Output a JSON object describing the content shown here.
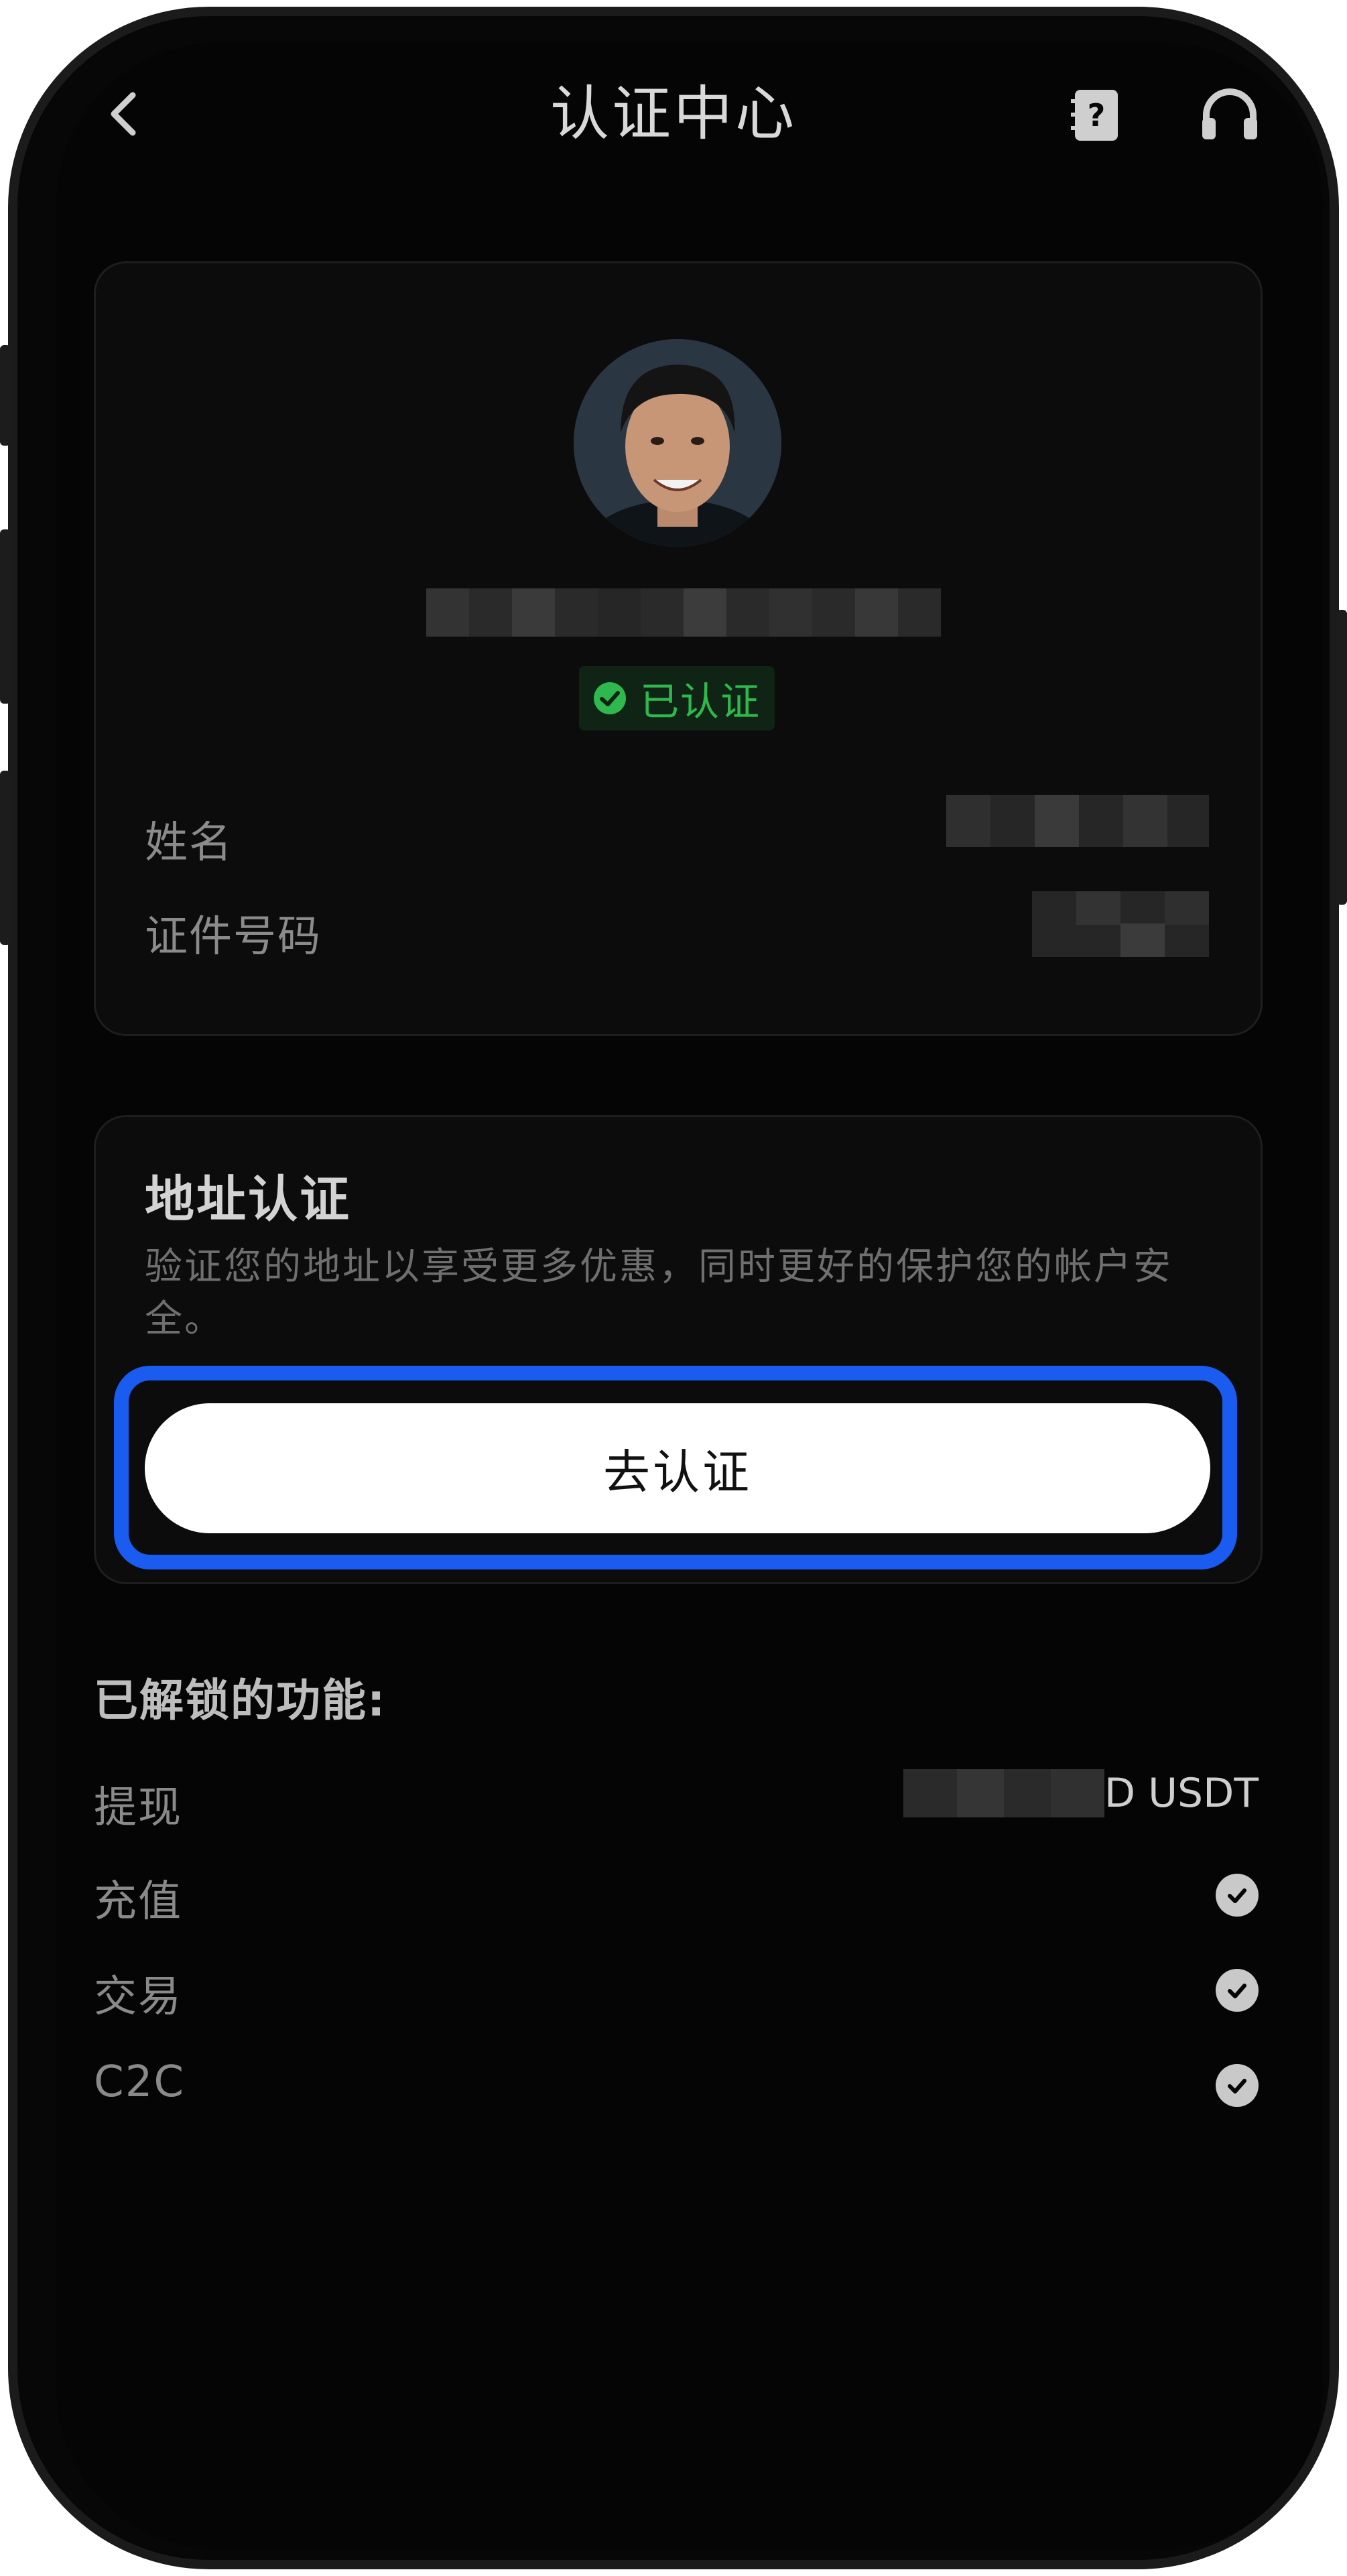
{
  "header": {
    "title": "认证中心",
    "back_icon": "chevron-left-icon",
    "help_icon": "question-book-icon",
    "support_icon": "headset-icon"
  },
  "profile": {
    "avatar": "user-avatar-photo",
    "verified_badge": "已认证",
    "fields": [
      {
        "label": "姓名"
      },
      {
        "label": "证件号码"
      }
    ]
  },
  "address_verification": {
    "title": "地址认证",
    "description": "验证您的地址以享受更多优惠，同时更好的保护您的帐户安全。",
    "button_label": "去认证"
  },
  "unlocked": {
    "title": "已解锁的功能:",
    "features": [
      {
        "label": "提现",
        "value": "D USDT"
      },
      {
        "label": "充值",
        "status": "check-icon"
      },
      {
        "label": "交易",
        "status": "check-icon"
      },
      {
        "label": "C2C",
        "status": "check-icon"
      }
    ]
  },
  "colors": {
    "background": "#050505",
    "card": "#0c0c0c",
    "verified_green": "#2fb84d",
    "highlight_blue": "#1a5cf0",
    "button": "#ffffff"
  }
}
